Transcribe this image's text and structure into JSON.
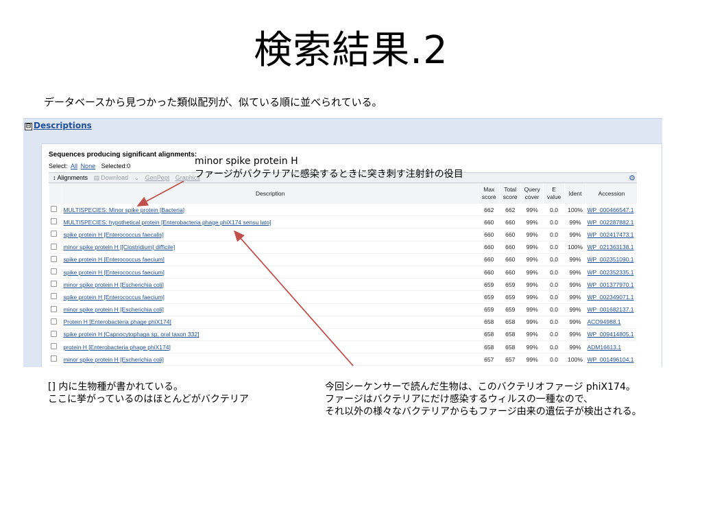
{
  "slide": {
    "title": "検索結果.2",
    "subtitle": "データベースから見つかった類似配列が、似ている順に並べられている。"
  },
  "panel": {
    "header_toggle": "⊟",
    "header_link": "Descriptions",
    "heading": "Sequences producing significant alignments:",
    "select_label": "Select:",
    "select_all": "All",
    "select_none": "None",
    "selected": "Selected:0",
    "toolbar": {
      "alignments": "Alignments",
      "download": "Download",
      "separator": "⌄",
      "genpept": "GenPept",
      "graphics": "Graphics"
    },
    "columns": {
      "description": "Description",
      "max_score_1": "Max",
      "max_score_2": "score",
      "total_score_1": "Total",
      "total_score_2": "score",
      "query_cover_1": "Query",
      "query_cover_2": "cover",
      "e_value_1": "E",
      "e_value_2": "value",
      "ident": "Ident",
      "accession": "Accession"
    },
    "rows": [
      {
        "desc": "MULTISPECIES: Minor spike protein [Bacteria]",
        "max": "662",
        "total": "662",
        "cover": "99%",
        "e": "0.0",
        "ident": "100%",
        "acc": "WP_000466547.1"
      },
      {
        "desc": "MULTISPECIES: hypothetical protein [Enterobacteria phage phiX174 sensu lato]",
        "max": "660",
        "total": "660",
        "cover": "99%",
        "e": "0.0",
        "ident": "99%",
        "acc": "WP_002287882.1"
      },
      {
        "desc": "spike protein H [Enterococcus faecalis]",
        "max": "660",
        "total": "660",
        "cover": "99%",
        "e": "0.0",
        "ident": "99%",
        "acc": "WP_002417473.1"
      },
      {
        "desc": "minor spike protein H [[Clostridium] difficile]",
        "max": "660",
        "total": "660",
        "cover": "99%",
        "e": "0.0",
        "ident": "100%",
        "acc": "WP_021363138.1"
      },
      {
        "desc": "spike protein H [Enterococcus faecium]",
        "max": "660",
        "total": "660",
        "cover": "99%",
        "e": "0.0",
        "ident": "99%",
        "acc": "WP_002351090.1"
      },
      {
        "desc": "spike protein H [Enterococcus faecium]",
        "max": "660",
        "total": "660",
        "cover": "99%",
        "e": "0.0",
        "ident": "99%",
        "acc": "WP_002352335.1"
      },
      {
        "desc": "minor spike protein H [Escherichia coli]",
        "max": "659",
        "total": "659",
        "cover": "99%",
        "e": "0.0",
        "ident": "99%",
        "acc": "WP_001377970.1"
      },
      {
        "desc": "spike protein H [Enterococcus faecium]",
        "max": "659",
        "total": "659",
        "cover": "99%",
        "e": "0.0",
        "ident": "99%",
        "acc": "WP_002349071.1"
      },
      {
        "desc": "minor spike protein H [Escherichia coli]",
        "max": "659",
        "total": "659",
        "cover": "99%",
        "e": "0.0",
        "ident": "99%",
        "acc": "WP_001682137.1"
      },
      {
        "desc": "Protein H [Enterobacteria phage phiX174]",
        "max": "658",
        "total": "658",
        "cover": "99%",
        "e": "0.0",
        "ident": "99%",
        "acc": "ACO94988.1"
      },
      {
        "desc": "spike protein H [Capnocytophaga sp. oral taxon 332]",
        "max": "658",
        "total": "658",
        "cover": "99%",
        "e": "0.0",
        "ident": "99%",
        "acc": "WP_009414805.1"
      },
      {
        "desc": "protein H [Enterobacteria phage phiX174]",
        "max": "658",
        "total": "658",
        "cover": "99%",
        "e": "0.0",
        "ident": "99%",
        "acc": "ADM16613.1"
      },
      {
        "desc": "minor spike protein H [Escherichia coli]",
        "max": "657",
        "total": "657",
        "cover": "99%",
        "e": "0.0",
        "ident": "100%",
        "acc": "WP_001496104.1"
      }
    ]
  },
  "callout": {
    "line1": "minor spike protein H",
    "line2": "ファージがバクテリアに感染するときに突き刺す注射針の役目"
  },
  "note_left": {
    "line1": "[] 内に生物種が書かれている。",
    "line2": "ここに挙がっているのはほとんどがバクテリア"
  },
  "note_right": {
    "line1": "今回シーケンサーで読んだ生物は、このバクテリオファージ phiX174。",
    "line2": "ファージはバクテリアにだけ感染するウィルスの一種なので、",
    "line3": "それ以外の様々なバクテリアからもファージ由来の遺伝子が検出される。"
  },
  "colors": {
    "arrow": "#c0504d",
    "link": "#1f4e9a",
    "panel_bg": "#dde6f2"
  },
  "icons": {
    "toolbar_gear": "gear-icon",
    "header_toggle": "collapse-icon"
  }
}
